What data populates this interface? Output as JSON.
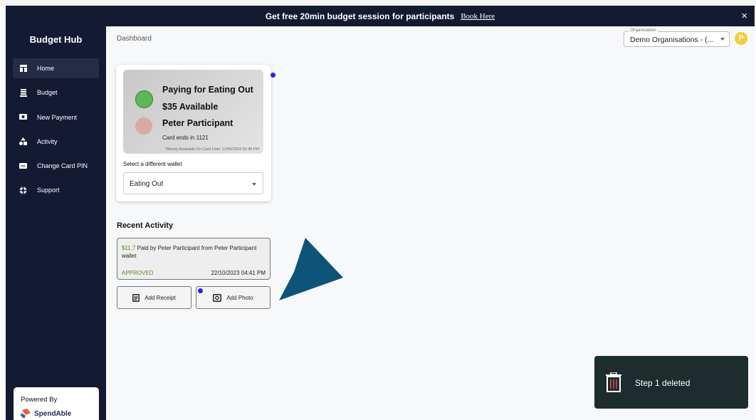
{
  "banner": {
    "text": "Get free 20min budget session for participants",
    "link": "Book Here",
    "close": "×"
  },
  "sidebar": {
    "brand": "Budget Hub",
    "items": [
      {
        "label": "Home",
        "icon": "home-icon",
        "active": true
      },
      {
        "label": "Budget",
        "icon": "budget-icon"
      },
      {
        "label": "New Payment",
        "icon": "payment-icon"
      },
      {
        "label": "Activity",
        "icon": "activity-icon"
      },
      {
        "label": "Change Card PIN",
        "icon": "pin-icon"
      },
      {
        "label": "Support",
        "icon": "support-icon"
      }
    ],
    "powered_by": "Powered By",
    "powered_brand": "SpendAble"
  },
  "header": {
    "title": "Dashboard",
    "org_label": "Organisation",
    "org_value": "Demo Organisations - (...",
    "avatar": "P"
  },
  "wallet": {
    "card_title": "Paying for Eating Out",
    "available": "$35 Available",
    "participant": "Peter Participant",
    "card_ends": "Card ends in 1121",
    "note": "*Money Available On Card Until: 11/06/2024 02:48 PM",
    "select_label": "Select a different wallet",
    "select_value": "Eating Out"
  },
  "recent": {
    "title": "Recent Activity",
    "item": {
      "amount": "$11.7",
      "desc": " Paid by Peter Participant from Peter Participant wallet",
      "status": "APPROVED",
      "date": "22/10/2023 04:41 PM"
    },
    "add_receipt": "Add Receipt",
    "add_photo": "Add Photo"
  },
  "toast": {
    "text": "Step 1 deleted",
    "icon": "trash-icon"
  },
  "colors": {
    "sidebar_bg": "#151a33",
    "accent_dot": "#2a1ef2",
    "approved": "#5d8a2a",
    "pointer": "#0d5478",
    "avatar": "#f2cf37",
    "toast_bg": "#1d2d2d"
  }
}
